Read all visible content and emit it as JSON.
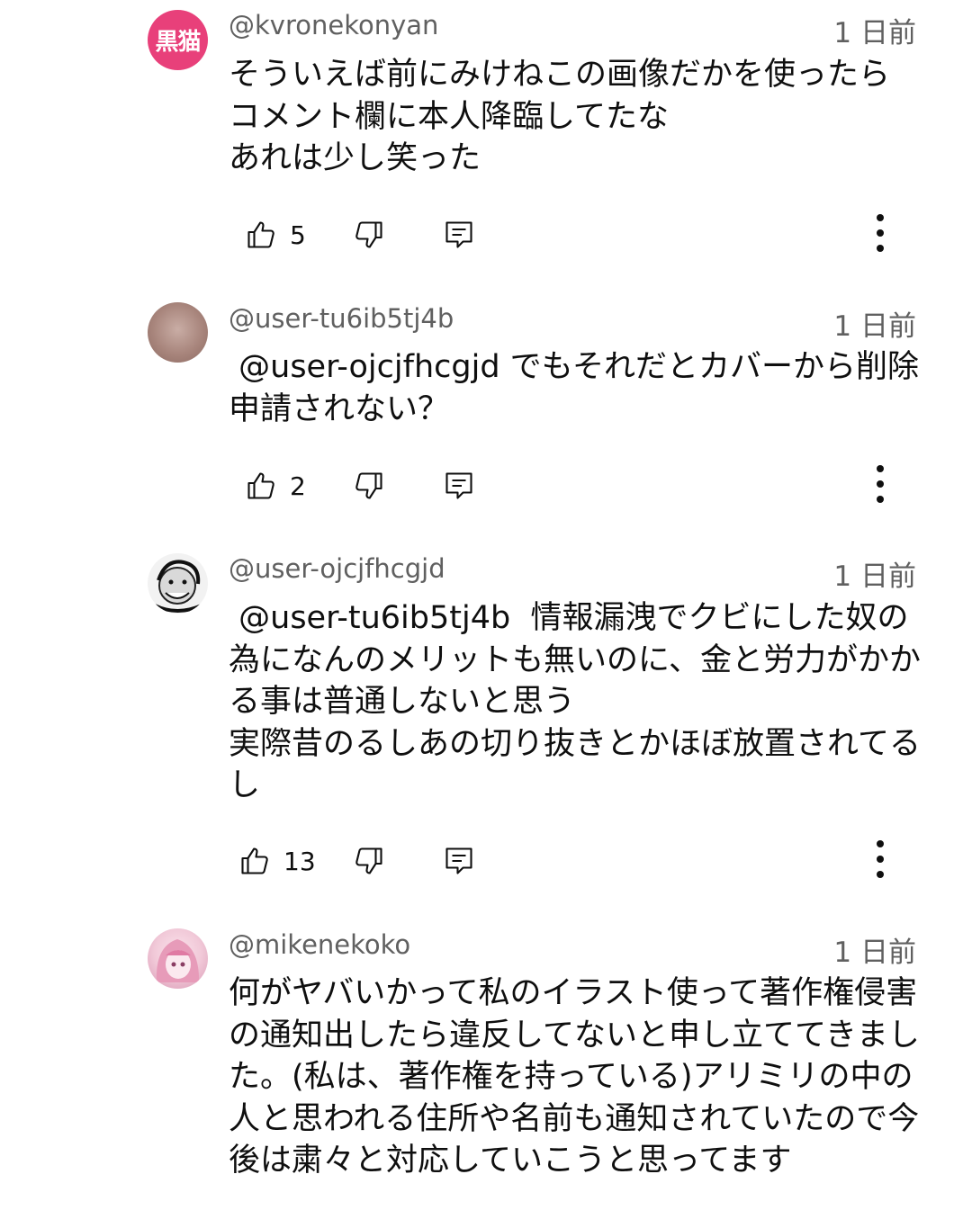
{
  "comments": [
    {
      "avatar_text": "黒猫",
      "avatar_color": "#e8407a",
      "handle": "@kvronekonyan",
      "time": "1 日前",
      "text": "そういえば前にみけねこの画像だかを使ったら\nコメント欄に本人降臨してたな\nあれは少し笑った",
      "likes": "5"
    },
    {
      "avatar_color": "#a8857c",
      "handle": "@user-tu6ib5tj4b",
      "time": "1 日前",
      "text": " @user-ojcjfhcgjd でもそれだとカバーから削除申請されない？",
      "likes": "2"
    },
    {
      "avatar_color": "#e6e6e6",
      "handle": "@user-ojcjfhcgjd",
      "time": "1 日前",
      "text": " @user-tu6ib5tj4b  情報漏洩でクビにした奴の為になんのメリットも無いのに、金と労力がかかる事は普通しないと思う\n実際昔のるしあの切り抜きとかほぼ放置されてるし",
      "likes": "13"
    },
    {
      "avatar_color": "#f1c9d8",
      "handle": "@mikenekoko",
      "time": "1 日前",
      "text": "何がヤバいかって私のイラスト使って著作権侵害の通知出したら違反してないと申し立ててきました。(私は、著作権を持っている)アリミリの中の人と思われる住所や名前も通知されていたので今後は粛々と対応していこうと思ってます"
    }
  ]
}
